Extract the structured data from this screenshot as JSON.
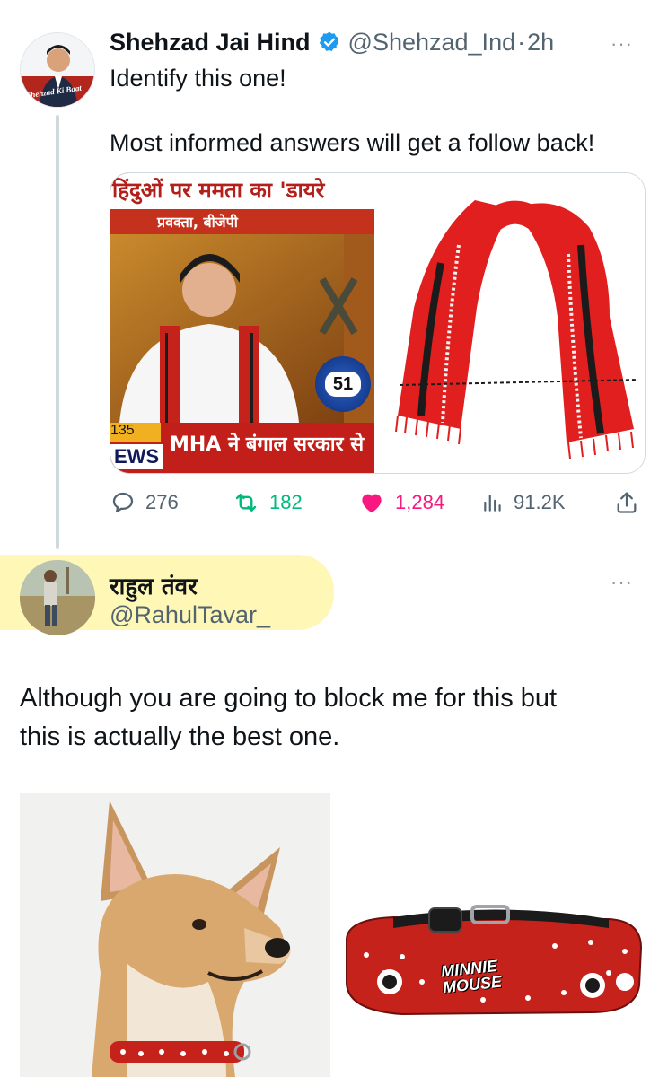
{
  "tweet": {
    "author_name": "Shehzad Jai Hind",
    "handle": "@Shehzad_Ind",
    "separator": "·",
    "time": "2h",
    "more": "···",
    "text_line1": "Identify this one!",
    "text_line2": "Most informed answers will get a follow back!",
    "avatar_caption": "Shehzad Ki Baat",
    "media": {
      "headline": "हिंदुओं पर ममता का 'डायरे",
      "subtitle": "प्रवक्ता, बीजेपी",
      "ticker": "MHA ने बंगाल सरकार से",
      "ticker_brand": "EWS",
      "ticker_number": "135",
      "badge": "51"
    },
    "stats": {
      "replies": "276",
      "retweets": "182",
      "likes": "1,284",
      "views": "91.2K"
    }
  },
  "reply": {
    "author_name": "राहुल तंवर",
    "handle": "@RahulTavar_",
    "more": "···",
    "text_line1": "Although you are going to block me for this but",
    "text_line2": "this is actually the best one.",
    "collar_text1": "MINNIE",
    "collar_text2": "MOUSE"
  },
  "colors": {
    "verified": "#1d9bf0",
    "like": "#f91880",
    "retweet": "#00ba7c",
    "muted": "#536471"
  }
}
